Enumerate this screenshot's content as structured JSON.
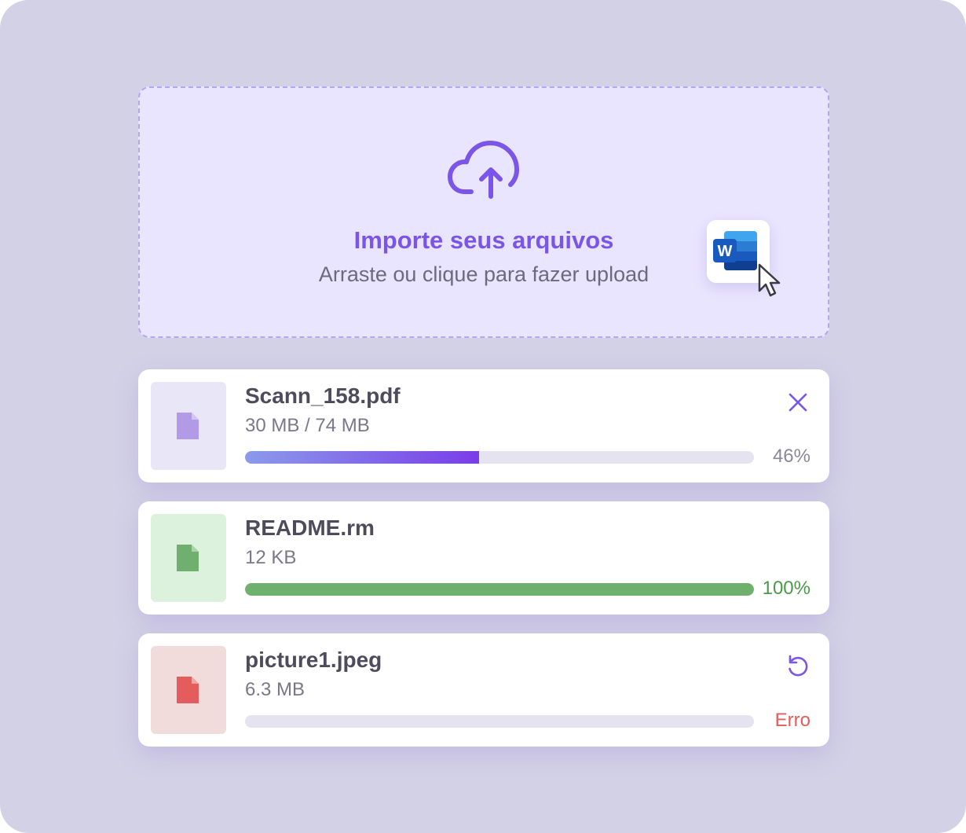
{
  "dropzone": {
    "title": "Importe seus arquivos",
    "subtitle": "Arraste ou clique para fazer upload",
    "icon": "cloud-upload-icon",
    "dragged_file_icon": "word-file-icon",
    "dragged_file_letter": "W"
  },
  "colors": {
    "accent": "#7a55e8",
    "background": "#d3d1e6",
    "dropzone_bg": "#eae5ff",
    "success": "#6fb06f",
    "error": "#e35d5d"
  },
  "files": [
    {
      "name": "Scann_158.pdf",
      "size": "30 MB / 74 MB",
      "progress": 0.46,
      "status": "46%",
      "state": "uploading",
      "action_icon": "close-icon"
    },
    {
      "name": "README.rm",
      "size": "12 KB",
      "progress": 1.0,
      "status": "100%",
      "state": "complete",
      "action_icon": ""
    },
    {
      "name": "picture1.jpeg",
      "size": "6.3 MB",
      "progress": 0,
      "status": "Erro",
      "state": "error",
      "action_icon": "retry-icon"
    }
  ]
}
